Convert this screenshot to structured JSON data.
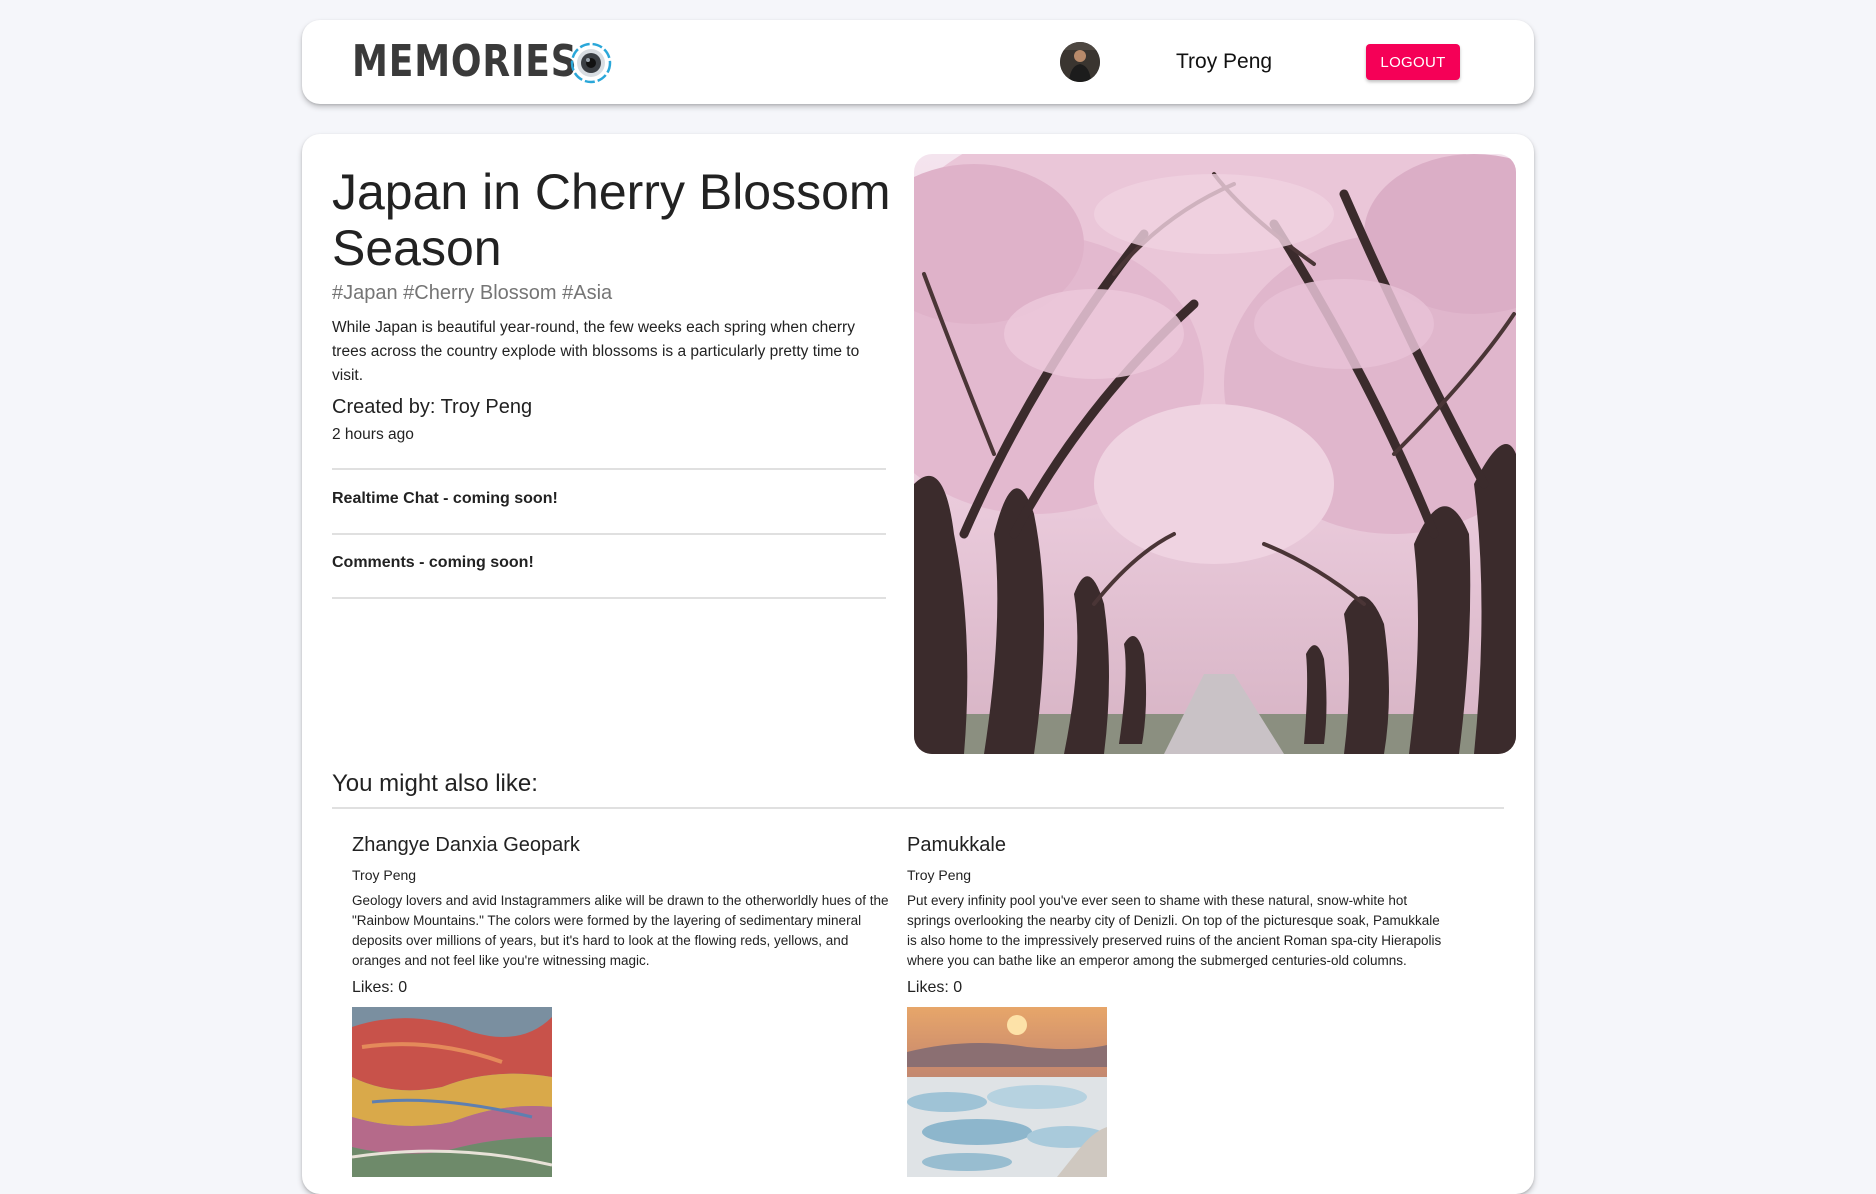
{
  "header": {
    "brand": "MEMORIES",
    "user_name": "Troy Peng",
    "logout_label": "LOGOUT",
    "accent_color": "#f50057"
  },
  "post": {
    "title": "Japan in Cherry Blossom Season",
    "tags": "#Japan #Cherry Blossom #Asia",
    "description": "While Japan is beautiful year-round, the few weeks each spring when cherry trees across the country explode with blossoms is a particularly pretty time to visit.",
    "created_by": "Created by: Troy Peng",
    "time_ago": "2 hours ago",
    "chat_note": "Realtime Chat - coming soon!",
    "comments_note": "Comments - coming soon!"
  },
  "recommendations": {
    "heading": "You might also like:",
    "items": [
      {
        "title": "Zhangye Danxia Geopark",
        "author": "Troy Peng",
        "description": "Geology lovers and avid Instagrammers alike will be drawn to the otherworldly hues of the \"Rainbow Mountains.\" The colors were formed by the layering of sedimentary mineral deposits over millions of years, but it's hard to look at the flowing reds, yellows, and oranges and not feel like you're witnessing magic.",
        "likes": "Likes: 0"
      },
      {
        "title": "Pamukkale",
        "author": "Troy Peng",
        "description": "Put every infinity pool you've ever seen to shame with these natural, snow-white hot springs overlooking the nearby city of Denizli. On top of the picturesque soak, Pamukkale is also home to the impressively preserved ruins of the ancient Roman spa-city Hierapolis where you can bathe like an emperor among the submerged centuries-old columns.",
        "likes": "Likes: 0"
      }
    ]
  }
}
